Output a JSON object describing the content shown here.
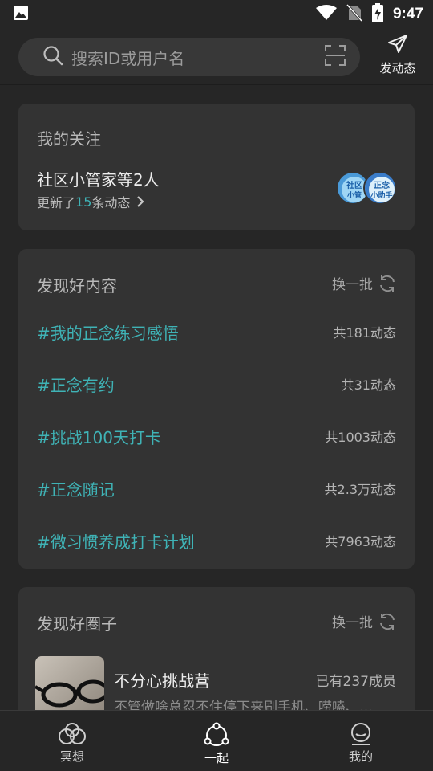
{
  "status_bar": {
    "time": "9:47"
  },
  "search": {
    "placeholder": "搜索ID或用户名"
  },
  "post": {
    "label": "发动态"
  },
  "following": {
    "title": "我的关注",
    "names": "社区小管家等2人",
    "update_prefix": "更新了",
    "update_count": "15",
    "update_suffix": "条动态"
  },
  "discover_content": {
    "title": "发现好内容",
    "refresh_label": "换一批",
    "topics": [
      {
        "name": "#我的正念练习感悟",
        "count": "共181动态"
      },
      {
        "name": "#正念有约",
        "count": "共31动态"
      },
      {
        "name": "#挑战100天打卡",
        "count": "共1003动态"
      },
      {
        "name": "#正念随记",
        "count": "共2.3万动态"
      },
      {
        "name": "#微习惯养成打卡计划",
        "count": "共7963动态"
      }
    ]
  },
  "discover_circles": {
    "title": "发现好圈子",
    "refresh_label": "换一批",
    "items": [
      {
        "name": "不分心挑战营",
        "members": "已有237成员",
        "desc": "不管做啥总忍不住停下来刷手机、唠嗑、…"
      }
    ]
  },
  "bottom_nav": [
    {
      "label": "冥想",
      "icon": "meditation-icon"
    },
    {
      "label": "一起",
      "icon": "together-icon",
      "active": true
    },
    {
      "label": "我的",
      "icon": "profile-icon"
    }
  ],
  "colors": {
    "accent": "#3fb3b6",
    "background": "#262626",
    "card": "#333333"
  }
}
